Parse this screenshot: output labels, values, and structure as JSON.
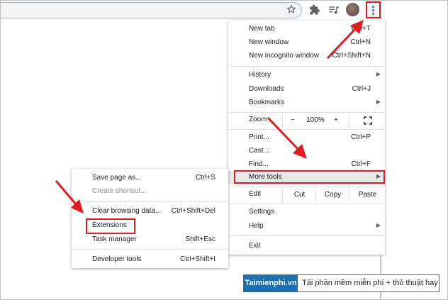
{
  "menu": {
    "items": {
      "new_tab": {
        "label": "New tab",
        "shortcut": "Ctrl+T"
      },
      "new_window": {
        "label": "New window",
        "shortcut": "Ctrl+N"
      },
      "new_incognito": {
        "label": "New incognito window",
        "shortcut": "Ctrl+Shift+N"
      },
      "history": {
        "label": "History"
      },
      "downloads": {
        "label": "Downloads",
        "shortcut": "Ctrl+J"
      },
      "bookmarks": {
        "label": "Bookmarks"
      },
      "print": {
        "label": "Print...",
        "shortcut": "Ctrl+P"
      },
      "cast": {
        "label": "Cast..."
      },
      "find": {
        "label": "Find...",
        "shortcut": "Ctrl+F"
      },
      "more_tools": {
        "label": "More tools"
      },
      "settings": {
        "label": "Settings"
      },
      "help": {
        "label": "Help"
      },
      "exit": {
        "label": "Exit"
      }
    },
    "zoom": {
      "label": "Zoom",
      "minus": "−",
      "value": "100%",
      "plus": "+"
    },
    "edit": {
      "label": "Edit",
      "cut": "Cut",
      "copy": "Copy",
      "paste": "Paste"
    }
  },
  "submenu": {
    "save_page": {
      "label": "Save page as...",
      "shortcut": "Ctrl+S"
    },
    "create_shortcut": {
      "label": "Create shortcut..."
    },
    "clear_browsing": {
      "label": "Clear browsing data...",
      "shortcut": "Ctrl+Shift+Del"
    },
    "extensions": {
      "label": "Extensions"
    },
    "task_manager": {
      "label": "Task manager",
      "shortcut": "Shift+Esc"
    },
    "developer_tools": {
      "label": "Developer tools",
      "shortcut": "Ctrl+Shift+I"
    }
  },
  "watermark": {
    "brand": "Taimienphi.vn",
    "text": "Tải phần mềm miễn phí + thủ thuật hay"
  },
  "colors": {
    "highlight_red": "#e01b22",
    "watermark_blue": "#1b6fb3"
  }
}
